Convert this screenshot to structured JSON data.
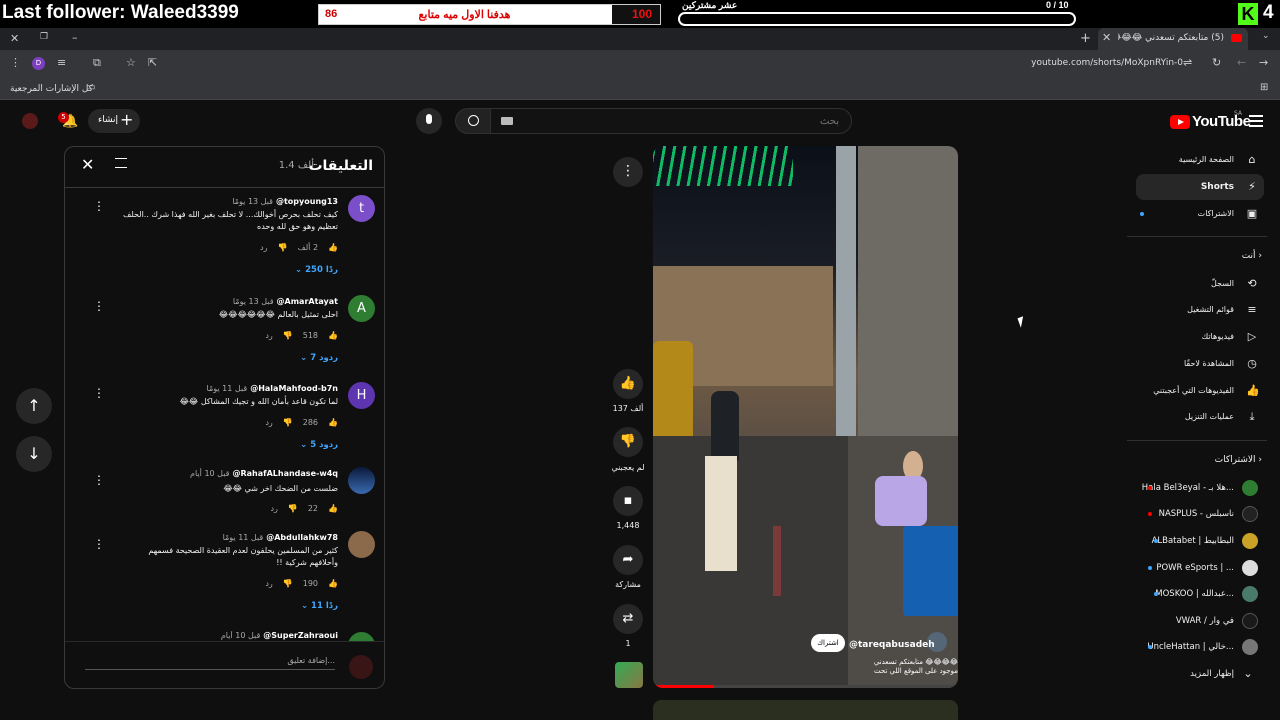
{
  "overlay": {
    "follower": "Last follower: Waleed3399",
    "goal_current": "100",
    "goal_text": "هدفنا الاول ميه متابع",
    "goal_target": "86",
    "goal_fraction": 0.14,
    "subs_label": "عشر مشتركين",
    "subs_count": "0 / 10",
    "kick_num": "4"
  },
  "browser": {
    "tab_title": "(5) متابعتكم تسعدني 😂😂😂 #اكسبلور",
    "url": "youtube.com/shorts/MoXpnRYin-0",
    "bookmarks_label": "كل الإشارات المرجعية",
    "profile_initial": "D"
  },
  "youtube": {
    "logo_text": "YouTube",
    "region": "SA",
    "search_placeholder": "بحث",
    "create_label": "إنشاء",
    "notif_count": "5"
  },
  "sidebar": {
    "main": [
      {
        "label": "الصفحة الرئيسية",
        "icon": "⌂"
      },
      {
        "label": "Shorts",
        "icon": "⚡"
      },
      {
        "label": "الاشتراكات",
        "icon": "▣"
      }
    ],
    "you_header": "أنت",
    "you_items": [
      {
        "label": "السجلّ",
        "icon": "⟲"
      },
      {
        "label": "قوائم التشغيل",
        "icon": "≡"
      },
      {
        "label": "فيديوهاتك",
        "icon": "▷"
      },
      {
        "label": "المشاهدة لاحقًا",
        "icon": "◷"
      },
      {
        "label": "الفيديوهات التي أعجبتني",
        "icon": "👍"
      },
      {
        "label": "عمليات التنزيل",
        "icon": "⤓"
      }
    ],
    "subs_header": "الاشتراكات",
    "subs": [
      {
        "label": "Hala Bel3eyal - هلا بـ...",
        "color": "#2e7d32"
      },
      {
        "label": "NASPLUS - ناسبلس",
        "color": "#222222"
      },
      {
        "label": "ALBatabet | البطابيط",
        "color": "#c9a227"
      },
      {
        "label": "POWR eSports | ...",
        "color": "#dddddd"
      },
      {
        "label": "MOSKOO | عبدالله...",
        "color": "#4a7a6a"
      },
      {
        "label": "VWAR / في وار",
        "color": "#1a1a1a"
      },
      {
        "label": "UncleHattan | خالي...",
        "color": "#777777"
      }
    ],
    "show_more": "إظهار المزيد"
  },
  "video": {
    "channel": "@tareqabusadeh",
    "subscribe": "اشتراك",
    "caption_line1": "متابعتكم تسعدني 😂😂😂😂",
    "caption_line2": "موجود على الموقع اللي تحت",
    "progress_fraction": 0.2,
    "likes": "137 ألف",
    "dislike_label": "لم يعجبني",
    "comments_count": "1,448",
    "share_label": "مشاركة",
    "remix_count": "1"
  },
  "comments_panel": {
    "title": "التعليقات",
    "count": "1.4 ألف",
    "add_placeholder": "إضافة تعليق...",
    "items": [
      {
        "author": "@topyoung13",
        "time": "قبل 13 يومًا",
        "text": "كيف تحلف بحرص أخوالك... لا تحلف بغير الله فهذا شرك ..الحلف تعظيم وهو حق لله وحده",
        "likes": "2 ألف",
        "reply": "رد",
        "replies": "250 ردًا",
        "avatar": "t",
        "color": "#7b4fc9"
      },
      {
        "author": "@AmarAtayat",
        "time": "قبل 13 يومًا",
        "text": "احلى تمثيل بالعالم 😂😂😂😂😂😂",
        "likes": "518",
        "reply": "رد",
        "replies": "7 ردود",
        "avatar": "A",
        "color": "#2e7d32"
      },
      {
        "author": "@HalaMahfood-b7n",
        "time": "قبل 11 يومًا",
        "text": "لما تكون قاعد بأمان الله و تجيك المشاكل 😂😂",
        "likes": "286",
        "reply": "رد",
        "replies": "5 ردود",
        "avatar": "H",
        "color": "#5e35b1"
      },
      {
        "author": "@RahafALhandase-w4q",
        "time": "قبل 10 أيام",
        "text": "ضلست من الضحك اخر شي 😂😂",
        "likes": "22",
        "reply": "رد",
        "replies": "",
        "avatar": "",
        "color": "#1a3a6a"
      },
      {
        "author": "@Abdullahkw78",
        "time": "قبل 11 يومًا",
        "text": "كثير من المسلمين يحلفون لعدم العقيدة الصحيحة فسمهم وأحلافهم شركية !!",
        "likes": "190",
        "reply": "رد",
        "replies": "11 ردًا",
        "avatar": "",
        "color": "#8a6a4a"
      },
      {
        "author": "@SuperZahraoui",
        "time": "قبل 10 أيام",
        "text": "",
        "likes": "",
        "reply": "",
        "replies": "",
        "avatar": "",
        "color": "#2e7d32"
      }
    ]
  }
}
